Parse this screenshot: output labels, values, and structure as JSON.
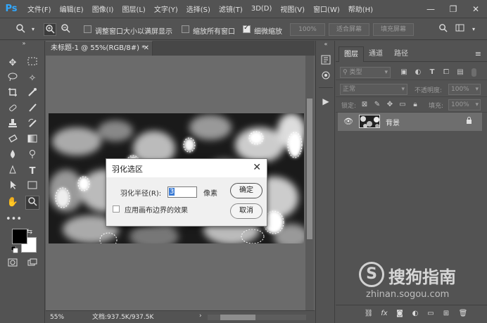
{
  "app": {
    "logo": "Ps"
  },
  "menu": [
    "文件(F)",
    "编辑(E)",
    "图像(I)",
    "图层(L)",
    "文字(Y)",
    "选择(S)",
    "滤镜(T)",
    "3D(D)",
    "视图(V)",
    "窗口(W)",
    "帮助(H)"
  ],
  "window_controls": [
    "—",
    "❐",
    "✕"
  ],
  "options": {
    "resize_windows_label": "调整窗口大小以满屏显示",
    "resize_windows_checked": false,
    "zoom_all_label": "缩放所有窗口",
    "zoom_all_checked": false,
    "scrubby_zoom_label": "细微缩放",
    "scrubby_zoom_checked": true,
    "btn_100": "100%",
    "btn_fit": "适合屏幕",
    "btn_fill": "填充屏幕"
  },
  "document": {
    "tab_title": "未标题-1 @ 55%(RGB/8#) *",
    "zoom": "55%",
    "doc_info": "文档:937.5K/937.5K"
  },
  "dialog": {
    "title": "羽化选区",
    "radius_label": "羽化半径(R):",
    "radius_value": "3",
    "unit": "像素",
    "ok": "确定",
    "cancel": "取消",
    "apply_canvas_label": "应用画布边界的效果",
    "apply_canvas_checked": false
  },
  "layers_panel": {
    "tabs": [
      "图层",
      "通道",
      "路径"
    ],
    "active_tab": "图层",
    "filter_kind": "类型",
    "blend_mode": "正常",
    "opacity_label": "不透明度:",
    "opacity_value": "100%",
    "lock_label": "锁定:",
    "fill_label": "填充:",
    "fill_value": "100%",
    "layers": [
      {
        "name": "背景",
        "visible": true,
        "locked": true
      }
    ],
    "footer_icons": [
      "link-icon",
      "fx-icon",
      "mask-icon",
      "adjustment-icon",
      "group-icon",
      "new-layer-icon",
      "trash-icon"
    ]
  },
  "watermark": {
    "brand": "搜狗指南",
    "url": "zhinan.sogou.com"
  },
  "colors": {
    "accent": "#31a8ff",
    "panel": "#535353",
    "canvas_bg": "#6b6b6b"
  }
}
